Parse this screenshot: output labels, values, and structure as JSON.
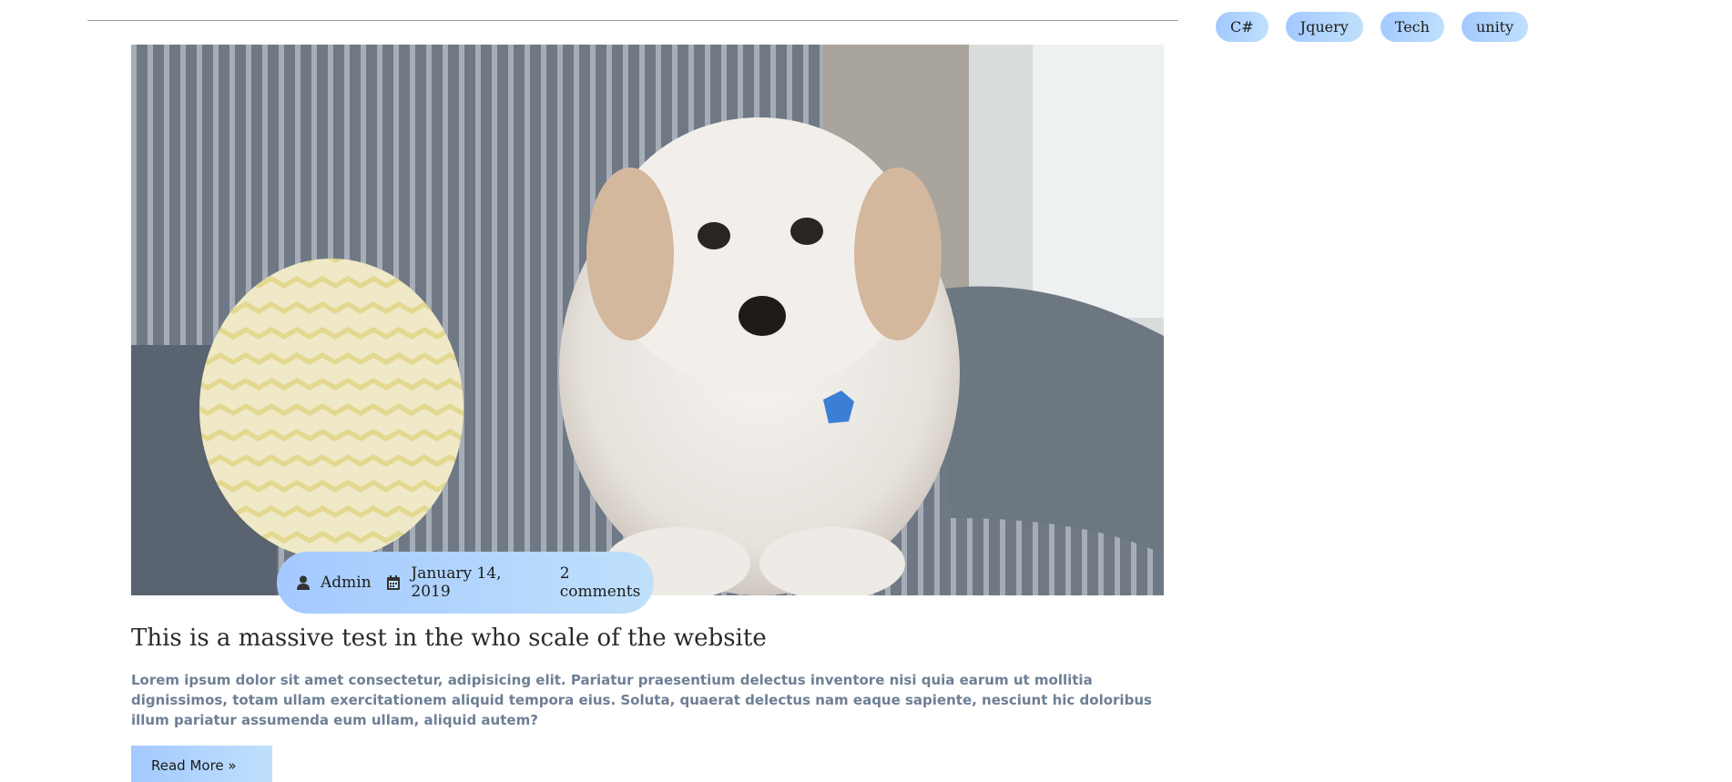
{
  "post": {
    "image_icon": "dog-photo",
    "meta": {
      "author": "Admin",
      "date": "January 14, 2019",
      "comments": "2 comments",
      "author_icon": "user-icon",
      "date_icon": "calendar-icon"
    },
    "title": "This is a massive test in the who scale of the website",
    "excerpt": "Lorem ipsum dolor sit amet consectetur, adipisicing elit. Pariatur praesentium delectus inventore nisi quia earum ut mollitia dignissimos, totam ullam exercitationem aliquid tempora eius. Soluta, quaerat delectus nam eaque sapiente, nesciunt hic doloribus illum pariatur assumenda eum ullam, aliquid autem?",
    "read_more": "Read More »"
  },
  "sidebar": {
    "tags": [
      "C#",
      "Jquery",
      "Tech",
      "unity"
    ]
  },
  "colors": {
    "accent_start": "#a4c9ff",
    "accent_end": "#bfe0fb",
    "excerpt_text": "#6e7f95"
  }
}
